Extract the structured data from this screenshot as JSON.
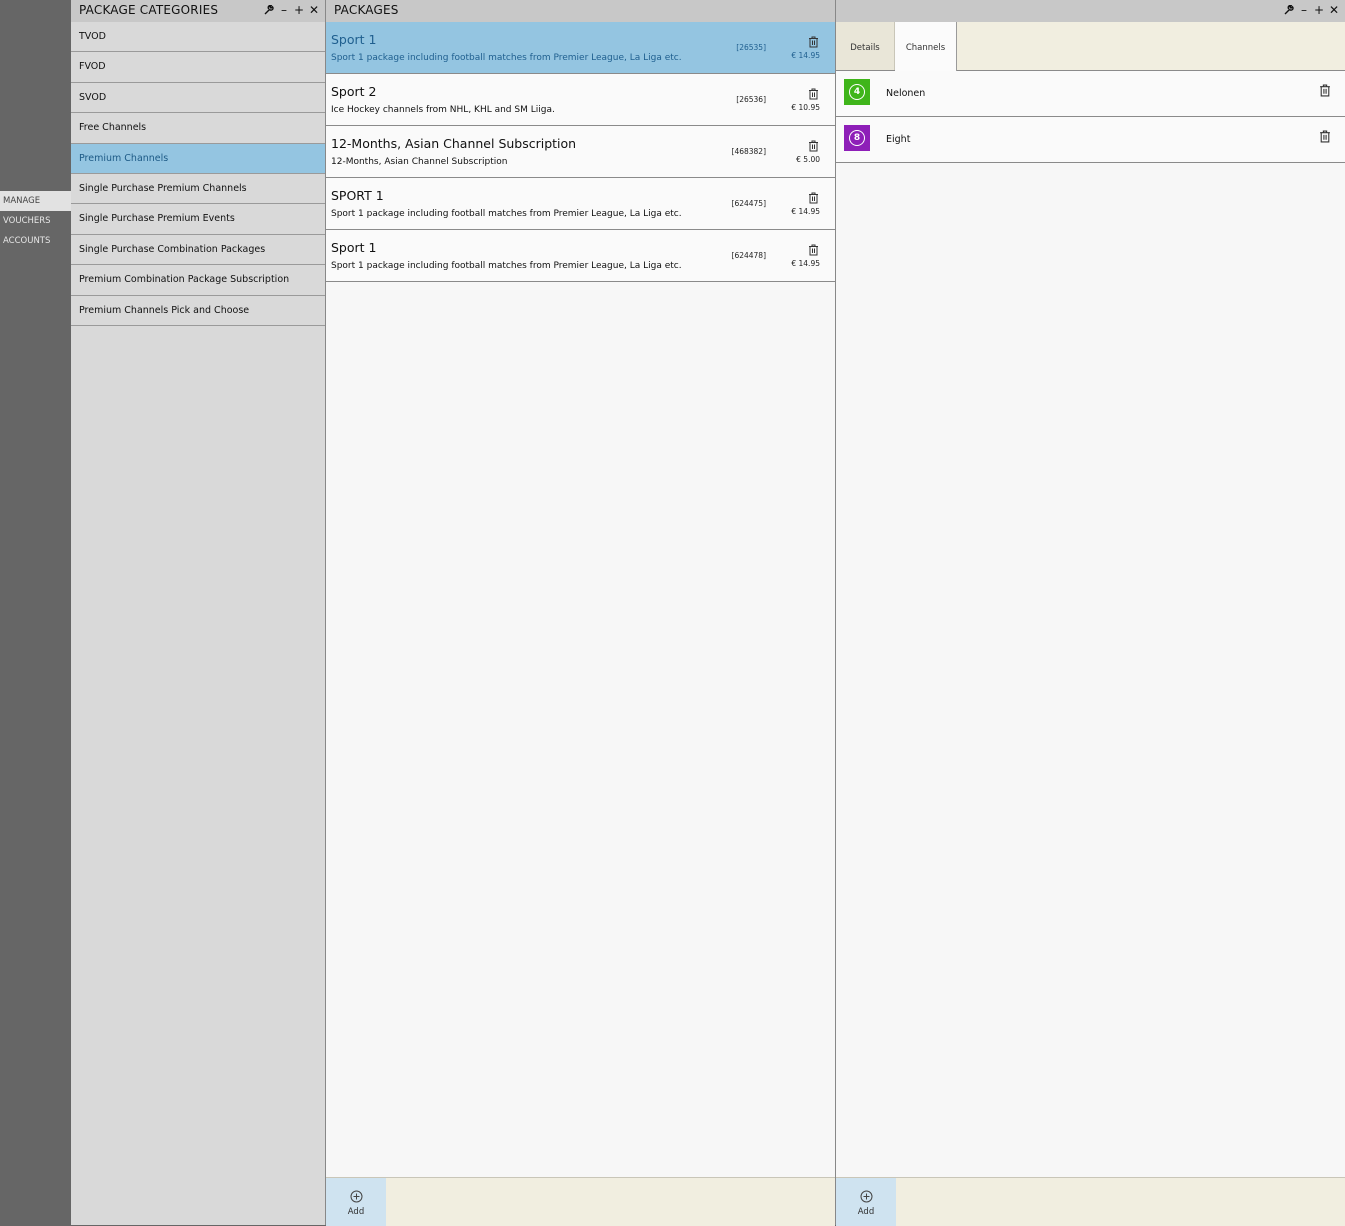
{
  "nav": {
    "items": [
      {
        "label": "MANAGE",
        "active": true
      },
      {
        "label": "VOUCHERS",
        "active": false
      },
      {
        "label": "ACCOUNTS",
        "active": false
      }
    ]
  },
  "categories": {
    "title": "PACKAGE CATEGORIES",
    "items": [
      {
        "label": "TVOD"
      },
      {
        "label": "FVOD"
      },
      {
        "label": "SVOD"
      },
      {
        "label": "Free Channels"
      },
      {
        "label": "Premium Channels"
      },
      {
        "label": "Single Purchase Premium Channels"
      },
      {
        "label": "Single Purchase Premium Events"
      },
      {
        "label": "Single Purchase Combination Packages"
      },
      {
        "label": "Premium Combination Package Subscription"
      },
      {
        "label": "Premium Channels Pick and Choose"
      }
    ],
    "selected_index": 4
  },
  "packages": {
    "title": "PACKAGES",
    "items": [
      {
        "title": "Sport 1",
        "description": "Sport 1 package including football matches from Premier League, La Liga etc.",
        "id": "[26535]",
        "price": "€ 14.95"
      },
      {
        "title": "Sport 2",
        "description": "Ice Hockey channels from NHL, KHL and SM Liiga.",
        "id": "[26536]",
        "price": "€ 10.95"
      },
      {
        "title": "12-Months, Asian Channel Subscription",
        "description": "12-Months, Asian Channel Subscription",
        "id": "[468382]",
        "price": "€ 5.00"
      },
      {
        "title": "SPORT 1",
        "description": "Sport 1 package including football matches from Premier League, La Liga etc.",
        "id": "[624475]",
        "price": "€ 14.95"
      },
      {
        "title": "Sport 1",
        "description": "Sport 1 package including football matches from Premier League, La Liga etc.",
        "id": "[624478]",
        "price": "€ 14.95"
      }
    ],
    "selected_index": 0,
    "add_label": "Add"
  },
  "details": {
    "tabs": [
      {
        "label": "Details",
        "active": false
      },
      {
        "label": "Channels",
        "active": true
      }
    ],
    "channels": [
      {
        "name": "Nelonen",
        "logo_text": "4",
        "logo_color": "#3fb51a"
      },
      {
        "name": "Eight",
        "logo_text": "8",
        "logo_color": "#8e1fb8"
      }
    ],
    "add_label": "Add"
  },
  "colors": {
    "selected": "#94c5e1",
    "selected_text": "#1f5f8f",
    "nav_bg": "#666666",
    "tab_bar_bg": "#f1eee0"
  }
}
